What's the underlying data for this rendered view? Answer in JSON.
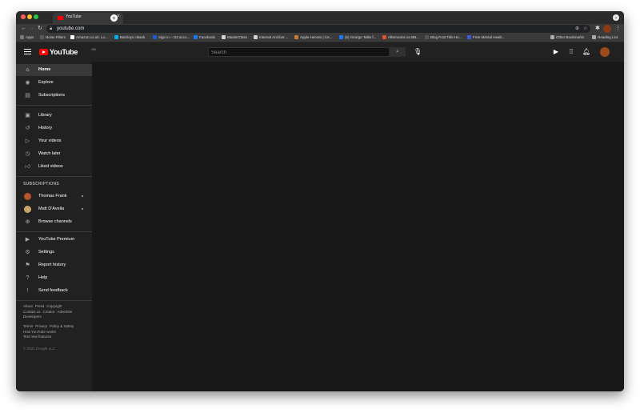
{
  "browser": {
    "tab_title": "YouTube",
    "tab_close": "×",
    "new_tab": "+",
    "url": "youtube.com",
    "bookmarks": [
      {
        "label": "Apps",
        "color": "#7a7a7a"
      },
      {
        "label": "Noise Filters",
        "color": "#5a5a5a"
      },
      {
        "label": "Amazon.co.uk: Lo...",
        "color": "#ffffff"
      },
      {
        "label": "Barclays i-Bank",
        "color": "#00aeef"
      },
      {
        "label": "Sign in – O2 acco...",
        "color": "#1e5ad7"
      },
      {
        "label": "Facebook",
        "color": "#1877f2"
      },
      {
        "label": "MasterClass",
        "color": "#d0d0d0"
      },
      {
        "label": "Internet Archive:...",
        "color": "#d0d0d0"
      },
      {
        "label": "Apple Heroes | Ce...",
        "color": "#c77b2b"
      },
      {
        "label": "(6) George Talks f...",
        "color": "#1877f2"
      },
      {
        "label": "Afternoons on BB...",
        "color": "#e0512b"
      },
      {
        "label": "Blog Post Title He...",
        "color": "#555555"
      },
      {
        "label": "Free Mental Healt...",
        "color": "#3b5bdb"
      }
    ],
    "other_bookmarks": "Other Bookmarks",
    "reading_list": "Reading List"
  },
  "header": {
    "logo_text": "YouTube",
    "country_code": "GB",
    "search_placeholder": "Search"
  },
  "sidebar": {
    "primary": [
      {
        "label": "Home",
        "icon": "home-icon",
        "active": true
      },
      {
        "label": "Explore",
        "icon": "compass-icon",
        "active": false
      },
      {
        "label": "Subscriptions",
        "icon": "subscriptions-icon",
        "active": false
      }
    ],
    "library": [
      {
        "label": "Library",
        "icon": "library-icon"
      },
      {
        "label": "History",
        "icon": "history-icon"
      },
      {
        "label": "Your videos",
        "icon": "your-videos-icon"
      },
      {
        "label": "Watch later",
        "icon": "clock-icon"
      },
      {
        "label": "Liked videos",
        "icon": "thumbs-up-icon"
      }
    ],
    "subscriptions_title": "SUBSCRIPTIONS",
    "subscriptions": [
      {
        "label": "Thomas Frank",
        "color": "#b5552c"
      },
      {
        "label": "Matt D'Avella",
        "color": "#c9a36a"
      }
    ],
    "browse_channels": "Browse channels",
    "more": [
      {
        "label": "YouTube Premium",
        "icon": "youtube-premium-icon"
      },
      {
        "label": "Settings",
        "icon": "gear-icon"
      },
      {
        "label": "Report history",
        "icon": "flag-icon"
      },
      {
        "label": "Help",
        "icon": "help-icon"
      },
      {
        "label": "Send feedback",
        "icon": "feedback-icon"
      }
    ],
    "footer_row1": [
      "About",
      "Press",
      "Copyright"
    ],
    "footer_row2": [
      "Contact us",
      "Creator",
      "Advertise"
    ],
    "footer_row3": [
      "Developers"
    ],
    "footer_row4": [
      "Terms",
      "Privacy",
      "Policy & Safety"
    ],
    "footer_row5": [
      "How YouTube works"
    ],
    "footer_row6": [
      "Test new features"
    ],
    "copyright": "© 2021 Google LLC"
  }
}
